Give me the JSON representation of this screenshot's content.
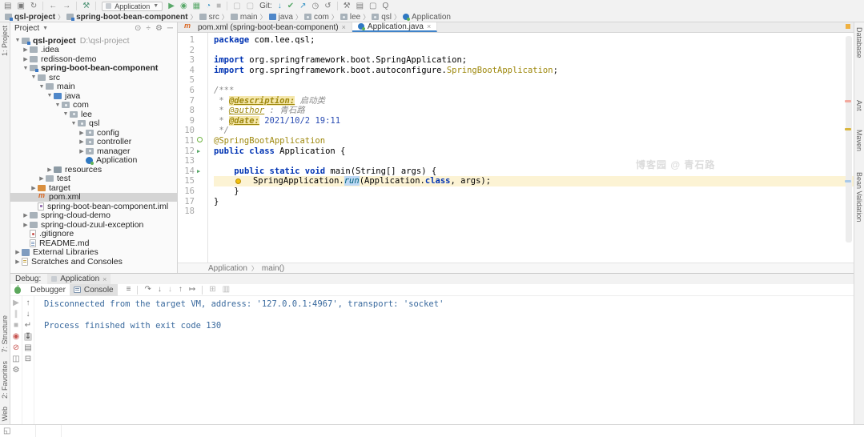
{
  "toolbar": {
    "run_config": "Application",
    "git_label": "Git:",
    "items": [
      {
        "name": "open-icon",
        "glyph": "▤"
      },
      {
        "name": "save-icon",
        "glyph": "▣"
      },
      {
        "name": "sync-icon",
        "glyph": "↻"
      },
      {
        "name": "sep"
      },
      {
        "name": "back-icon",
        "glyph": "←"
      },
      {
        "name": "forward-icon",
        "glyph": "→"
      },
      {
        "name": "sep"
      },
      {
        "name": "build-icon",
        "glyph": "⚒",
        "color": "g-build"
      },
      {
        "name": "sep"
      },
      {
        "name": "run-config-chip"
      },
      {
        "name": "run-icon",
        "glyph": "▶",
        "color": "g-green"
      },
      {
        "name": "debug-icon",
        "glyph": "◉",
        "color": "g-green"
      },
      {
        "name": "coverage-icon",
        "glyph": "▦",
        "color": "g-green"
      },
      {
        "name": "profiler-icon",
        "glyph": "◔",
        "color": "g-teal"
      },
      {
        "name": "stop-icon",
        "glyph": "■",
        "color": "g-dim"
      },
      {
        "name": "sep"
      },
      {
        "name": "find-icon",
        "glyph": "▢",
        "color": "g-dim"
      },
      {
        "name": "replace-icon",
        "glyph": "▢",
        "color": "g-dim"
      },
      {
        "name": "git-label"
      },
      {
        "name": "git-update-icon",
        "glyph": "↓",
        "color": "g-teal"
      },
      {
        "name": "git-commit-icon",
        "glyph": "✔",
        "color": "g-green"
      },
      {
        "name": "git-push-icon",
        "glyph": "↗",
        "color": "g-teal"
      },
      {
        "name": "history-icon",
        "glyph": "◷"
      },
      {
        "name": "rollback-icon",
        "glyph": "↺"
      },
      {
        "name": "sep"
      },
      {
        "name": "wrench-icon",
        "glyph": "⚒"
      },
      {
        "name": "toolwindows-icon",
        "glyph": "▤"
      },
      {
        "name": "layout-icon",
        "glyph": "▢"
      },
      {
        "name": "search-everywhere-icon",
        "glyph": "Q"
      }
    ]
  },
  "breadcrumb": {
    "items": [
      {
        "label": "qsl-project",
        "icon": "module",
        "bold": true
      },
      {
        "label": "spring-boot-bean-component",
        "icon": "module",
        "bold": true
      },
      {
        "label": "src",
        "icon": "folder"
      },
      {
        "label": "main",
        "icon": "folder"
      },
      {
        "label": "java",
        "icon": "src"
      },
      {
        "label": "com",
        "icon": "pkg"
      },
      {
        "label": "lee",
        "icon": "pkg"
      },
      {
        "label": "qsl",
        "icon": "pkg"
      },
      {
        "label": "Application",
        "icon": "cls"
      }
    ]
  },
  "project": {
    "title": "Project",
    "header_icons": [
      {
        "name": "locate-icon",
        "glyph": "⊙"
      },
      {
        "name": "collapse-all-icon",
        "glyph": "÷"
      },
      {
        "name": "settings-icon",
        "glyph": "⚙"
      },
      {
        "name": "hide-icon",
        "glyph": "─"
      }
    ],
    "tree": [
      {
        "label": "qsl-project",
        "suffix": "D:\\qsl-project",
        "level": 0,
        "chevron": "open",
        "icon": "module",
        "bold": true
      },
      {
        "label": ".idea",
        "level": 1,
        "chevron": "closed",
        "icon": "folder"
      },
      {
        "label": "redisson-demo",
        "level": 1,
        "chevron": "closed",
        "icon": "folder"
      },
      {
        "label": "spring-boot-bean-component",
        "level": 1,
        "chevron": "open",
        "icon": "module",
        "bold": true
      },
      {
        "label": "src",
        "level": 2,
        "chevron": "open",
        "icon": "folder"
      },
      {
        "label": "main",
        "level": 3,
        "chevron": "open",
        "icon": "folder"
      },
      {
        "label": "java",
        "level": 4,
        "chevron": "open",
        "icon": "folder-src"
      },
      {
        "label": "com",
        "level": 5,
        "chevron": "open",
        "icon": "package"
      },
      {
        "label": "lee",
        "level": 6,
        "chevron": "open",
        "icon": "package"
      },
      {
        "label": "qsl",
        "level": 7,
        "chevron": "open",
        "icon": "package"
      },
      {
        "label": "config",
        "level": 8,
        "chevron": "closed",
        "icon": "package"
      },
      {
        "label": "controller",
        "level": 8,
        "chevron": "closed",
        "icon": "package"
      },
      {
        "label": "manager",
        "level": 8,
        "chevron": "closed",
        "icon": "package"
      },
      {
        "label": "Application",
        "level": 8,
        "chevron": "none",
        "icon": "class"
      },
      {
        "label": "resources",
        "level": 4,
        "chevron": "closed",
        "icon": "folder-res"
      },
      {
        "label": "test",
        "level": 3,
        "chevron": "closed",
        "icon": "folder"
      },
      {
        "label": "target",
        "level": 2,
        "chevron": "closed",
        "icon": "folder-excluded"
      },
      {
        "label": "pom.xml",
        "level": 2,
        "chevron": "none",
        "icon": "maven",
        "selected": true
      },
      {
        "label": "spring-boot-bean-component.iml",
        "level": 2,
        "chevron": "none",
        "icon": "iml"
      },
      {
        "label": "spring-cloud-demo",
        "level": 1,
        "chevron": "closed",
        "icon": "folder"
      },
      {
        "label": "spring-cloud-zuul-exception",
        "level": 1,
        "chevron": "closed",
        "icon": "folder"
      },
      {
        "label": ".gitignore",
        "level": 1,
        "chevron": "none",
        "icon": "gitignore"
      },
      {
        "label": "README.md",
        "level": 1,
        "chevron": "none",
        "icon": "md"
      },
      {
        "label": "External Libraries",
        "level": 0,
        "chevron": "closed",
        "icon": "libs"
      },
      {
        "label": "Scratches and Consoles",
        "level": 0,
        "chevron": "closed",
        "icon": "scratch"
      }
    ]
  },
  "editor": {
    "tabs": [
      {
        "label": "pom.xml (spring-boot-bean-component)",
        "icon": "maven",
        "active": false
      },
      {
        "label": "Application.java",
        "icon": "cls",
        "active": true
      }
    ],
    "breadcrumb": [
      "Application",
      "main()"
    ],
    "watermark": "博客园 @ 青石路",
    "lines": [
      {
        "n": 1,
        "tokens": [
          {
            "t": "package",
            "s": "kw"
          },
          {
            "t": " com.lee.qsl;",
            "s": "p"
          }
        ]
      },
      {
        "n": 2,
        "tokens": []
      },
      {
        "n": 3,
        "tokens": [
          {
            "t": "import",
            "s": "kw"
          },
          {
            "t": " org.springframework.boot.SpringApplication;",
            "s": "p"
          }
        ]
      },
      {
        "n": 4,
        "tokens": [
          {
            "t": "import",
            "s": "kw"
          },
          {
            "t": " org.springframework.boot.autoconfigure.",
            "s": "p"
          },
          {
            "t": "SpringBootApplication",
            "s": "ann"
          },
          {
            "t": ";",
            "s": "p"
          }
        ]
      },
      {
        "n": 5,
        "tokens": []
      },
      {
        "n": 6,
        "tokens": [
          {
            "t": "/***",
            "s": "c"
          }
        ]
      },
      {
        "n": 7,
        "tokens": [
          {
            "t": " * ",
            "s": "c"
          },
          {
            "t": "@description:",
            "s": "tagh"
          },
          {
            "t": " 启动类",
            "s": "c"
          }
        ]
      },
      {
        "n": 8,
        "tokens": [
          {
            "t": " * ",
            "s": "c"
          },
          {
            "t": "@author",
            "s": "tag"
          },
          {
            "t": " : 青石路",
            "s": "c"
          }
        ]
      },
      {
        "n": 9,
        "tokens": [
          {
            "t": " * ",
            "s": "c"
          },
          {
            "t": "@date:",
            "s": "tagh"
          },
          {
            "t": " 2021/10/2 19:11",
            "s": "num"
          }
        ]
      },
      {
        "n": 10,
        "tokens": [
          {
            "t": " */",
            "s": "c"
          }
        ]
      },
      {
        "n": 11,
        "gutter": "spring",
        "tokens": [
          {
            "t": "@SpringBootApplication",
            "s": "ann"
          }
        ]
      },
      {
        "n": 12,
        "gutter": "runclass",
        "tokens": [
          {
            "t": "public class",
            "s": "kw"
          },
          {
            "t": " Application {",
            "s": "p"
          }
        ]
      },
      {
        "n": 13,
        "tokens": []
      },
      {
        "n": 14,
        "gutter": "run",
        "tokens": [
          {
            "t": "    ",
            "s": "p"
          },
          {
            "t": "public static void",
            "s": "kw"
          },
          {
            "t": " main(String[] args) {",
            "s": "p"
          }
        ]
      },
      {
        "n": 15,
        "hl": true,
        "tokens": [
          {
            "t": "    ",
            "s": "p"
          },
          {
            "t": "",
            "s": "bulb"
          },
          {
            "t": "  SpringApplication.",
            "s": "p"
          },
          {
            "t": "run",
            "s": "mh"
          },
          {
            "t": "(Application.",
            "s": "p"
          },
          {
            "t": "class",
            "s": "kw"
          },
          {
            "t": ", args);",
            "s": "p"
          }
        ]
      },
      {
        "n": 16,
        "tokens": [
          {
            "t": "    }",
            "s": "p"
          }
        ]
      },
      {
        "n": 17,
        "tokens": [
          {
            "t": "}",
            "s": "p"
          }
        ]
      },
      {
        "n": 18,
        "tokens": []
      }
    ]
  },
  "debug": {
    "title": "Debug:",
    "tab": "Application",
    "view_tabs": [
      {
        "label": "Debugger",
        "active": false
      },
      {
        "label": "Console",
        "active": true
      }
    ],
    "toolbar_icons": [
      {
        "name": "menu-icon",
        "glyph": "≡"
      },
      {
        "name": "sep"
      },
      {
        "name": "step-over-icon",
        "glyph": "↷"
      },
      {
        "name": "step-into-icon",
        "glyph": "↓"
      },
      {
        "name": "force-step-into-icon",
        "glyph": "↓",
        "color": "g-dim"
      },
      {
        "name": "step-out-icon",
        "glyph": "↑"
      },
      {
        "name": "run-to-cursor-icon",
        "glyph": "↦"
      },
      {
        "name": "sep"
      },
      {
        "name": "evaluate-expression-icon",
        "glyph": "⊞",
        "color": "g-dim"
      },
      {
        "name": "trace-icon",
        "glyph": "▥",
        "color": "g-dim"
      }
    ],
    "left_icons": [
      {
        "name": "resume-icon",
        "glyph": "▶",
        "color": "g-dim"
      },
      {
        "name": "pause-icon",
        "glyph": "∥",
        "color": "g-dim"
      },
      {
        "name": "stop-icon",
        "glyph": "■",
        "color": "g-dim"
      },
      {
        "name": "view-breakpoints-icon",
        "glyph": "◉",
        "color": "g-red"
      },
      {
        "name": "mute-breakpoints-icon",
        "glyph": "⊘",
        "color": "g-red"
      },
      {
        "name": "thread-dump-icon",
        "glyph": "◫"
      },
      {
        "name": "settings-icon",
        "glyph": "⚙"
      }
    ],
    "right_icons": [
      {
        "name": "up-stack-icon",
        "glyph": "↑"
      },
      {
        "name": "down-stack-icon",
        "glyph": "↓"
      },
      {
        "name": "soft-wrap-icon",
        "glyph": "↵"
      },
      {
        "name": "scroll-to-end-icon",
        "glyph": "↧",
        "sel": true
      },
      {
        "name": "print-icon",
        "glyph": "▤"
      },
      {
        "name": "clear-all-icon",
        "glyph": "⊟"
      }
    ],
    "console_lines": [
      "Disconnected from the target VM, address: '127.0.0.1:4967', transport: 'socket'",
      "",
      "Process finished with exit code 130"
    ]
  },
  "stripes": {
    "left_top": [
      "1: Project"
    ],
    "left_bottom": [
      "7: Structure",
      "2: Favorites",
      "Web"
    ],
    "right": [
      "Database",
      "Ant",
      "Maven",
      "Bean Validation"
    ]
  }
}
